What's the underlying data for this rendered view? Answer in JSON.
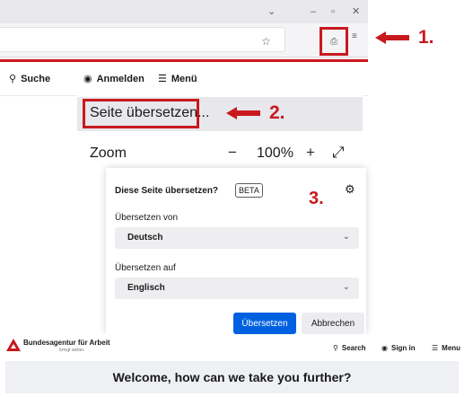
{
  "browser": {
    "window_controls": {
      "chevron": "⌄",
      "minimize": "–",
      "restore": "▫",
      "close": "✕"
    },
    "bookmark_icon": "star-icon",
    "translate_icon": "translate-icon",
    "menu_icon": "hamburger-icon"
  },
  "callouts": [
    "1.",
    "2.",
    "3."
  ],
  "accent_color": "#c8191e",
  "topnav": {
    "search": "Suche",
    "login": "Anmelden",
    "menu": "Menü"
  },
  "app_menu": {
    "translate_item": "Seite übersetzen...",
    "zoom_label": "Zoom",
    "zoom_minus": "−",
    "zoom_value": "100%",
    "zoom_plus": "+"
  },
  "translate_dialog": {
    "title": "Diese Seite übersetzen?",
    "badge": "BETA",
    "from_label": "Übersetzen von",
    "from_value": "Deutsch",
    "to_label": "Übersetzen auf",
    "to_value": "Englisch",
    "confirm_button": "Übersetzen",
    "cancel_button": "Abbrechen",
    "primary_color": "#0061e0"
  },
  "translated_page": {
    "org_name": "Bundesagentur für Arbeit",
    "slogan": "bringt weiter.",
    "nav_search": "Search",
    "nav_signin": "Sign in",
    "nav_menu": "Menu",
    "welcome": "Welcome, how can we take you further?"
  }
}
